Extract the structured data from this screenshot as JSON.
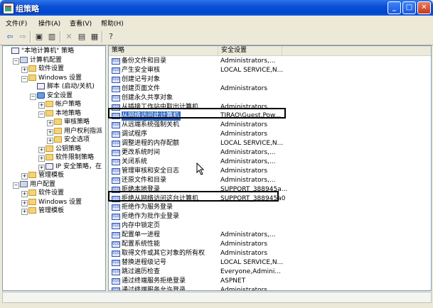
{
  "window": {
    "title": "组策略",
    "minimize": "_",
    "maximize": "□",
    "close": "✕"
  },
  "menu": [
    "文件(F)",
    "操作(A)",
    "查看(V)",
    "帮助(H)"
  ],
  "tree": [
    {
      "label": "\"本地计算机\" 策略",
      "indent": 0,
      "icon": "pol",
      "exp": ""
    },
    {
      "label": "计算机配置",
      "indent": 1,
      "icon": "pc",
      "exp": "−"
    },
    {
      "label": "软件设置",
      "indent": 2,
      "icon": "folder",
      "exp": "+"
    },
    {
      "label": "Windows 设置",
      "indent": 2,
      "icon": "folder",
      "exp": "−"
    },
    {
      "label": "脚本 (启动/关机)",
      "indent": 3,
      "icon": "pol",
      "exp": ""
    },
    {
      "label": "安全设置",
      "indent": 3,
      "icon": "sh",
      "exp": "−"
    },
    {
      "label": "帐户策略",
      "indent": 4,
      "icon": "folder",
      "exp": "+"
    },
    {
      "label": "本地策略",
      "indent": 4,
      "icon": "folder",
      "exp": "−"
    },
    {
      "label": "审核策略",
      "indent": 5,
      "icon": "folder",
      "exp": "+"
    },
    {
      "label": "用户权利指派",
      "indent": 5,
      "icon": "folder",
      "exp": "+"
    },
    {
      "label": "安全选项",
      "indent": 5,
      "icon": "folder",
      "exp": "+"
    },
    {
      "label": "公钥策略",
      "indent": 4,
      "icon": "folder",
      "exp": "+"
    },
    {
      "label": "软件限制策略",
      "indent": 4,
      "icon": "folder",
      "exp": "+"
    },
    {
      "label": "IP 安全策略，在",
      "indent": 4,
      "icon": "pol",
      "exp": "+"
    },
    {
      "label": "管理模板",
      "indent": 2,
      "icon": "folder",
      "exp": "+"
    },
    {
      "label": "用户配置",
      "indent": 1,
      "icon": "pc",
      "exp": "−"
    },
    {
      "label": "软件设置",
      "indent": 2,
      "icon": "folder",
      "exp": "+"
    },
    {
      "label": "Windows 设置",
      "indent": 2,
      "icon": "folder",
      "exp": "+"
    },
    {
      "label": "管理模板",
      "indent": 2,
      "icon": "folder",
      "exp": "+"
    }
  ],
  "columns": {
    "policy": "策略",
    "setting": "安全设置"
  },
  "rows": [
    {
      "name": "备份文件和目录",
      "setting": "Administrators,..."
    },
    {
      "name": "产生安全审核",
      "setting": "LOCAL SERVICE,N..."
    },
    {
      "name": "创建记号对象",
      "setting": ""
    },
    {
      "name": "创建页面文件",
      "setting": "Administrators"
    },
    {
      "name": "创建永久共享对象",
      "setting": ""
    },
    {
      "name": "从插接工作站中取出计算机",
      "setting": "Administrators,..."
    },
    {
      "name": "从网络访问此计算机",
      "setting": "TJRAO\\Guest,Pow...",
      "selected": true
    },
    {
      "name": "从远端系统强制关机",
      "setting": "Administrators"
    },
    {
      "name": "调试程序",
      "setting": "Administrators"
    },
    {
      "name": "调整进程的内存配额",
      "setting": "LOCAL SERVICE,N..."
    },
    {
      "name": "更改系统时间",
      "setting": "Administrators,..."
    },
    {
      "name": "关闭系统",
      "setting": "Administrators,..."
    },
    {
      "name": "管理审核和安全日志",
      "setting": "Administrators"
    },
    {
      "name": "还原文件和目录",
      "setting": "Administrators,..."
    },
    {
      "name": "拒绝本地登录",
      "setting": "SUPPORT_388945a..."
    },
    {
      "name": "拒绝从网络访问这台计算机",
      "setting": "SUPPORT_388945a0"
    },
    {
      "name": "拒绝作为服务登录",
      "setting": ""
    },
    {
      "name": "拒绝作为批作业登录",
      "setting": ""
    },
    {
      "name": "内存中锁定页",
      "setting": ""
    },
    {
      "name": "配置单一进程",
      "setting": "Administrators,..."
    },
    {
      "name": "配置系统性能",
      "setting": "Administrators"
    },
    {
      "name": "取得文件或其它对象的所有权",
      "setting": "Administrators"
    },
    {
      "name": "替换进程级记号",
      "setting": "LOCAL SERVICE,N..."
    },
    {
      "name": "跳过遍历检查",
      "setting": "Everyone,Admini..."
    },
    {
      "name": "通过终端服务拒绝登录",
      "setting": "ASPNET"
    },
    {
      "name": "通过终端服务允许登录",
      "setting": "Administrators,..."
    }
  ],
  "colors": {
    "titlebar": "#0a50d8",
    "selection": "#316ac5",
    "face": "#ece9d8"
  }
}
